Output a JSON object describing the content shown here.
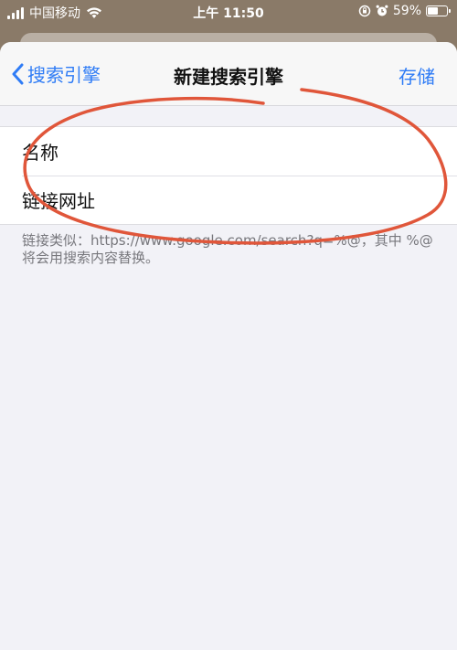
{
  "status_bar": {
    "carrier": "中国移动",
    "time": "上午 11:50",
    "battery_text": "59%",
    "battery_level": 0.59
  },
  "nav": {
    "back_label": "搜索引擎",
    "title": "新建搜索引擎",
    "save_label": "存储"
  },
  "form": {
    "name_placeholder": "名称",
    "url_placeholder": "链接网址"
  },
  "footnote": "链接类似：https://www.google.com/search?q=%@，其中 %@ 将会用搜索内容替换。",
  "colors": {
    "accent": "#2f7cf6",
    "annotation": "#e0563a"
  }
}
